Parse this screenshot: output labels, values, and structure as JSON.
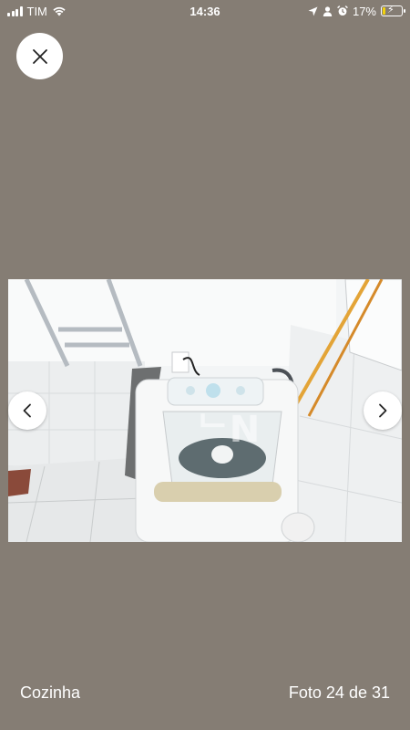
{
  "status_bar": {
    "carrier": "TIM",
    "time": "14:36",
    "battery_percent": "17%",
    "battery_level": 0.17,
    "icons": [
      "signal-icon",
      "wifi-icon",
      "location-icon",
      "person-icon",
      "alarm-icon",
      "battery-icon"
    ]
  },
  "viewer": {
    "close_icon": "close-icon",
    "prev_icon": "chevron-left-icon",
    "next_icon": "chevron-right-icon",
    "caption": "Cozinha",
    "counter": "Foto 24 de 31"
  },
  "colors": {
    "background": "#857d74",
    "button_bg": "#ffffff",
    "text": "#ffffff",
    "battery_low": "#f2d20d"
  }
}
